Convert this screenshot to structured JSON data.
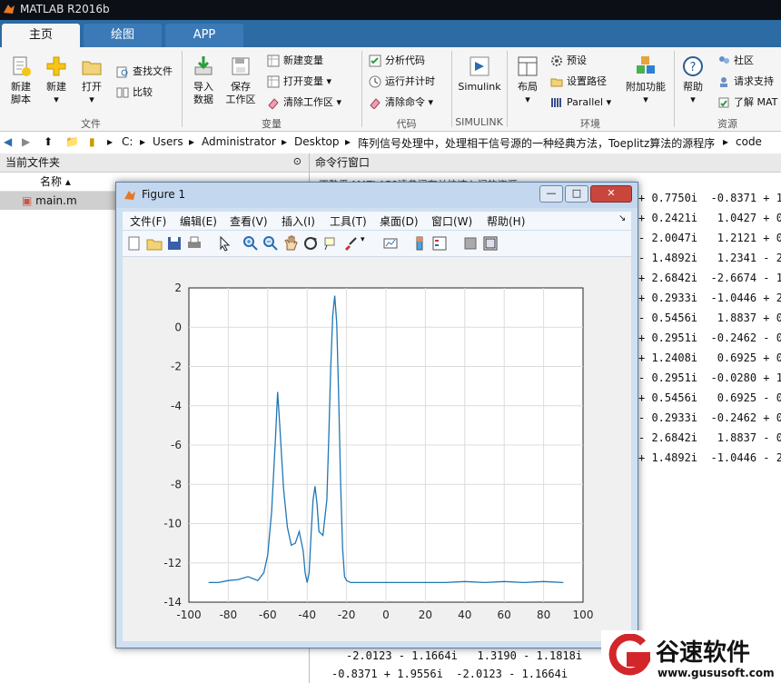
{
  "app": {
    "title": "MATLAB R2016b"
  },
  "tabs": [
    {
      "label": "主页"
    },
    {
      "label": "绘图"
    },
    {
      "label": "APP"
    }
  ],
  "ribbon": {
    "big_buttons": [
      {
        "label1": "新建",
        "label2": "脚本",
        "icon": "new-script-icon"
      },
      {
        "label1": "新建",
        "label2": "",
        "icon": "new-icon"
      },
      {
        "label1": "打开",
        "label2": "",
        "icon": "open-icon"
      },
      {
        "label1": "导入",
        "label2": "数据",
        "icon": "import-icon"
      },
      {
        "label1": "保存",
        "label2": "工作区",
        "icon": "save-workspace-icon"
      },
      {
        "label1": "Simulink",
        "label2": "",
        "icon": "simulink-icon"
      },
      {
        "label1": "布局",
        "label2": "",
        "icon": "layout-icon"
      },
      {
        "label1": "附加功能",
        "label2": "",
        "icon": "addons-icon"
      },
      {
        "label1": "帮助",
        "label2": "",
        "icon": "help-icon"
      }
    ],
    "small_buttons": {
      "find_files": "查找文件",
      "compare": "比较",
      "new_variable": "新建变量",
      "open_variable": "打开变量",
      "clear_workspace": "清除工作区",
      "analyze_code": "分析代码",
      "run_and_time": "运行并计时",
      "clear_commands": "清除命令",
      "preferences": "预设",
      "set_path": "设置路径",
      "parallel": "Parallel",
      "community": "社区",
      "request_support": "请求支持",
      "learn_matlab": "了解 MAT"
    },
    "groups": [
      "文件",
      "变量",
      "代码",
      "SIMULINK",
      "环境",
      "资源"
    ]
  },
  "address": {
    "crumbs": [
      "C:",
      "Users",
      "Administrator",
      "Desktop",
      "阵列信号处理中，处理相干信号源的一种经典方法，Toeplitz算法的源程序",
      "code"
    ]
  },
  "file_browser": {
    "title": "当前文件夹",
    "column": "名称",
    "files": [
      "main.m"
    ]
  },
  "command_window": {
    "title": "命令行窗口",
    "notice": "不熟悉 MATLAB?请参阅有关快速入门的资源。",
    "rows": [
      "+ 0.7750i  -0.8371 + 1",
      "+ 0.2421i   1.0427 + 0",
      "- 2.0047i   1.2121 + 0",
      "- 1.4892i   1.2341 - 2",
      "+ 2.6842i  -2.6674 - 1",
      "+ 0.2933i  -1.0446 + 2",
      "- 0.5456i   1.8837 + 0",
      "+ 0.2951i  -0.2462 - 0",
      "+ 1.2408i   0.6925 + 0",
      "- 0.2951i  -0.0280 + 1",
      "+ 0.5456i   0.6925 - 0",
      "- 0.2933i  -0.2462 + 0",
      "- 2.6842i   1.8837 - 0",
      "+ 1.4892i  -1.0446 - 2"
    ],
    "bottom_rows": [
      "-2.0123 - 1.1664i   1.3190 - 1.1818i",
      "-0.8371 + 1.9556i  -2.0123 - 1.1664i"
    ]
  },
  "figure": {
    "title": "Figure 1",
    "menus": [
      "文件(F)",
      "编辑(E)",
      "查看(V)",
      "插入(I)",
      "工具(T)",
      "桌面(D)",
      "窗口(W)",
      "帮助(H)"
    ],
    "window_buttons": {
      "minimize": "—",
      "maximize": "□",
      "close": "✕"
    }
  },
  "chart_data": {
    "type": "line",
    "title": "",
    "xlabel": "",
    "ylabel": "",
    "xlim": [
      -100,
      100
    ],
    "ylim": [
      -14,
      2
    ],
    "xticks": [
      -100,
      -80,
      -60,
      -40,
      -20,
      0,
      20,
      40,
      60,
      80,
      100
    ],
    "yticks": [
      2,
      0,
      -2,
      -4,
      -6,
      -8,
      -10,
      -12,
      -14
    ],
    "grid": true,
    "color": "#1f77b4",
    "x": [
      -90,
      -85,
      -80,
      -75,
      -70,
      -65,
      -62,
      -60,
      -58,
      -56,
      -55,
      -54,
      -52,
      -50,
      -48,
      -46,
      -44,
      -42,
      -41,
      -40,
      -39,
      -38,
      -37,
      -36,
      -35,
      -34,
      -32,
      -30,
      -29,
      -28,
      -27,
      -26,
      -25,
      -24,
      -23,
      -22,
      -21,
      -20,
      -18,
      -15,
      -10,
      0,
      10,
      20,
      30,
      40,
      50,
      60,
      70,
      80,
      90
    ],
    "y": [
      -13,
      -13,
      -12.9,
      -12.85,
      -12.7,
      -12.9,
      -12.5,
      -11.6,
      -9.4,
      -5.5,
      -3.3,
      -4.8,
      -8.2,
      -10.2,
      -11.1,
      -11.0,
      -10.4,
      -11.4,
      -12.5,
      -13.0,
      -12.5,
      -10.6,
      -8.8,
      -8.1,
      -9.0,
      -10.4,
      -10.6,
      -8.8,
      -5.5,
      -2.0,
      0.6,
      1.6,
      0.2,
      -3.5,
      -8.0,
      -11.3,
      -12.7,
      -12.9,
      -13.0,
      -13.0,
      -13.0,
      -13.0,
      -13.0,
      -13.0,
      -13.0,
      -12.95,
      -13.0,
      -12.95,
      -13.0,
      -12.95,
      -13.0
    ]
  },
  "watermark": {
    "name": "谷速软件",
    "url": "www.gususoft.com"
  }
}
